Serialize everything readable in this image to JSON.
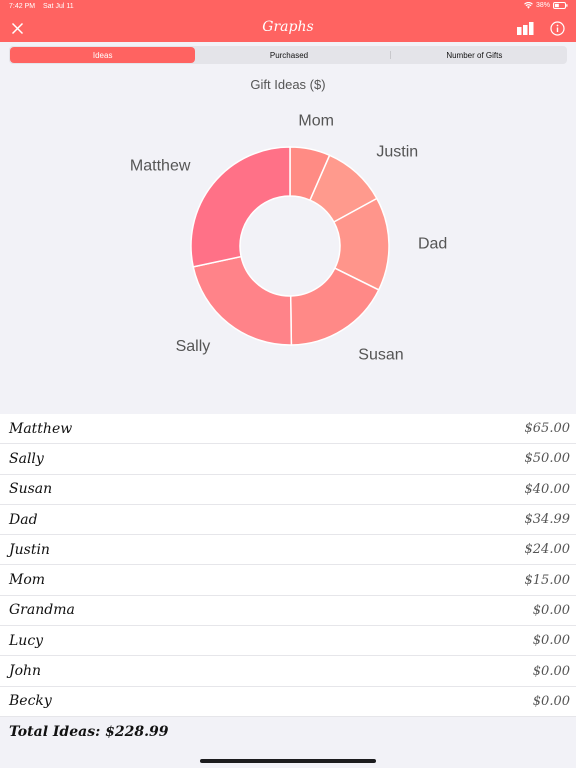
{
  "status": {
    "time": "7:42 PM",
    "date": "Sat Jul 11",
    "battery": "38%"
  },
  "nav": {
    "title": "Graphs",
    "icons": [
      "close-icon",
      "bar-chart-icon",
      "info-icon"
    ]
  },
  "segments": [
    {
      "label": "Ideas",
      "active": true
    },
    {
      "label": "Purchased",
      "active": false
    },
    {
      "label": "Number of Gifts",
      "active": false
    }
  ],
  "chart_data": {
    "type": "pie",
    "title": "Gift Ideas ($)",
    "categories": [
      "Mom",
      "Justin",
      "Dad",
      "Susan",
      "Sally",
      "Matthew"
    ],
    "values": [
      15.0,
      24.0,
      34.99,
      40.0,
      50.0,
      65.0
    ],
    "colors": [
      "#ff8b84",
      "#ff9a8d",
      "#ff958b",
      "#ff8987",
      "#ff8389",
      "#ff7187"
    ],
    "donut": true,
    "legend": "labels-outside"
  },
  "list": [
    {
      "name": "Matthew",
      "value": "$65.00"
    },
    {
      "name": "Sally",
      "value": "$50.00"
    },
    {
      "name": "Susan",
      "value": "$40.00"
    },
    {
      "name": "Dad",
      "value": "$34.99"
    },
    {
      "name": "Justin",
      "value": "$24.00"
    },
    {
      "name": "Mom",
      "value": "$15.00"
    },
    {
      "name": "Grandma",
      "value": "$0.00"
    },
    {
      "name": "Lucy",
      "value": "$0.00"
    },
    {
      "name": "John",
      "value": "$0.00"
    },
    {
      "name": "Becky",
      "value": "$0.00"
    }
  ],
  "total": "Total Ideas: $228.99",
  "colors": {
    "accent": "#ff6361",
    "background": "#f2f2f7"
  }
}
